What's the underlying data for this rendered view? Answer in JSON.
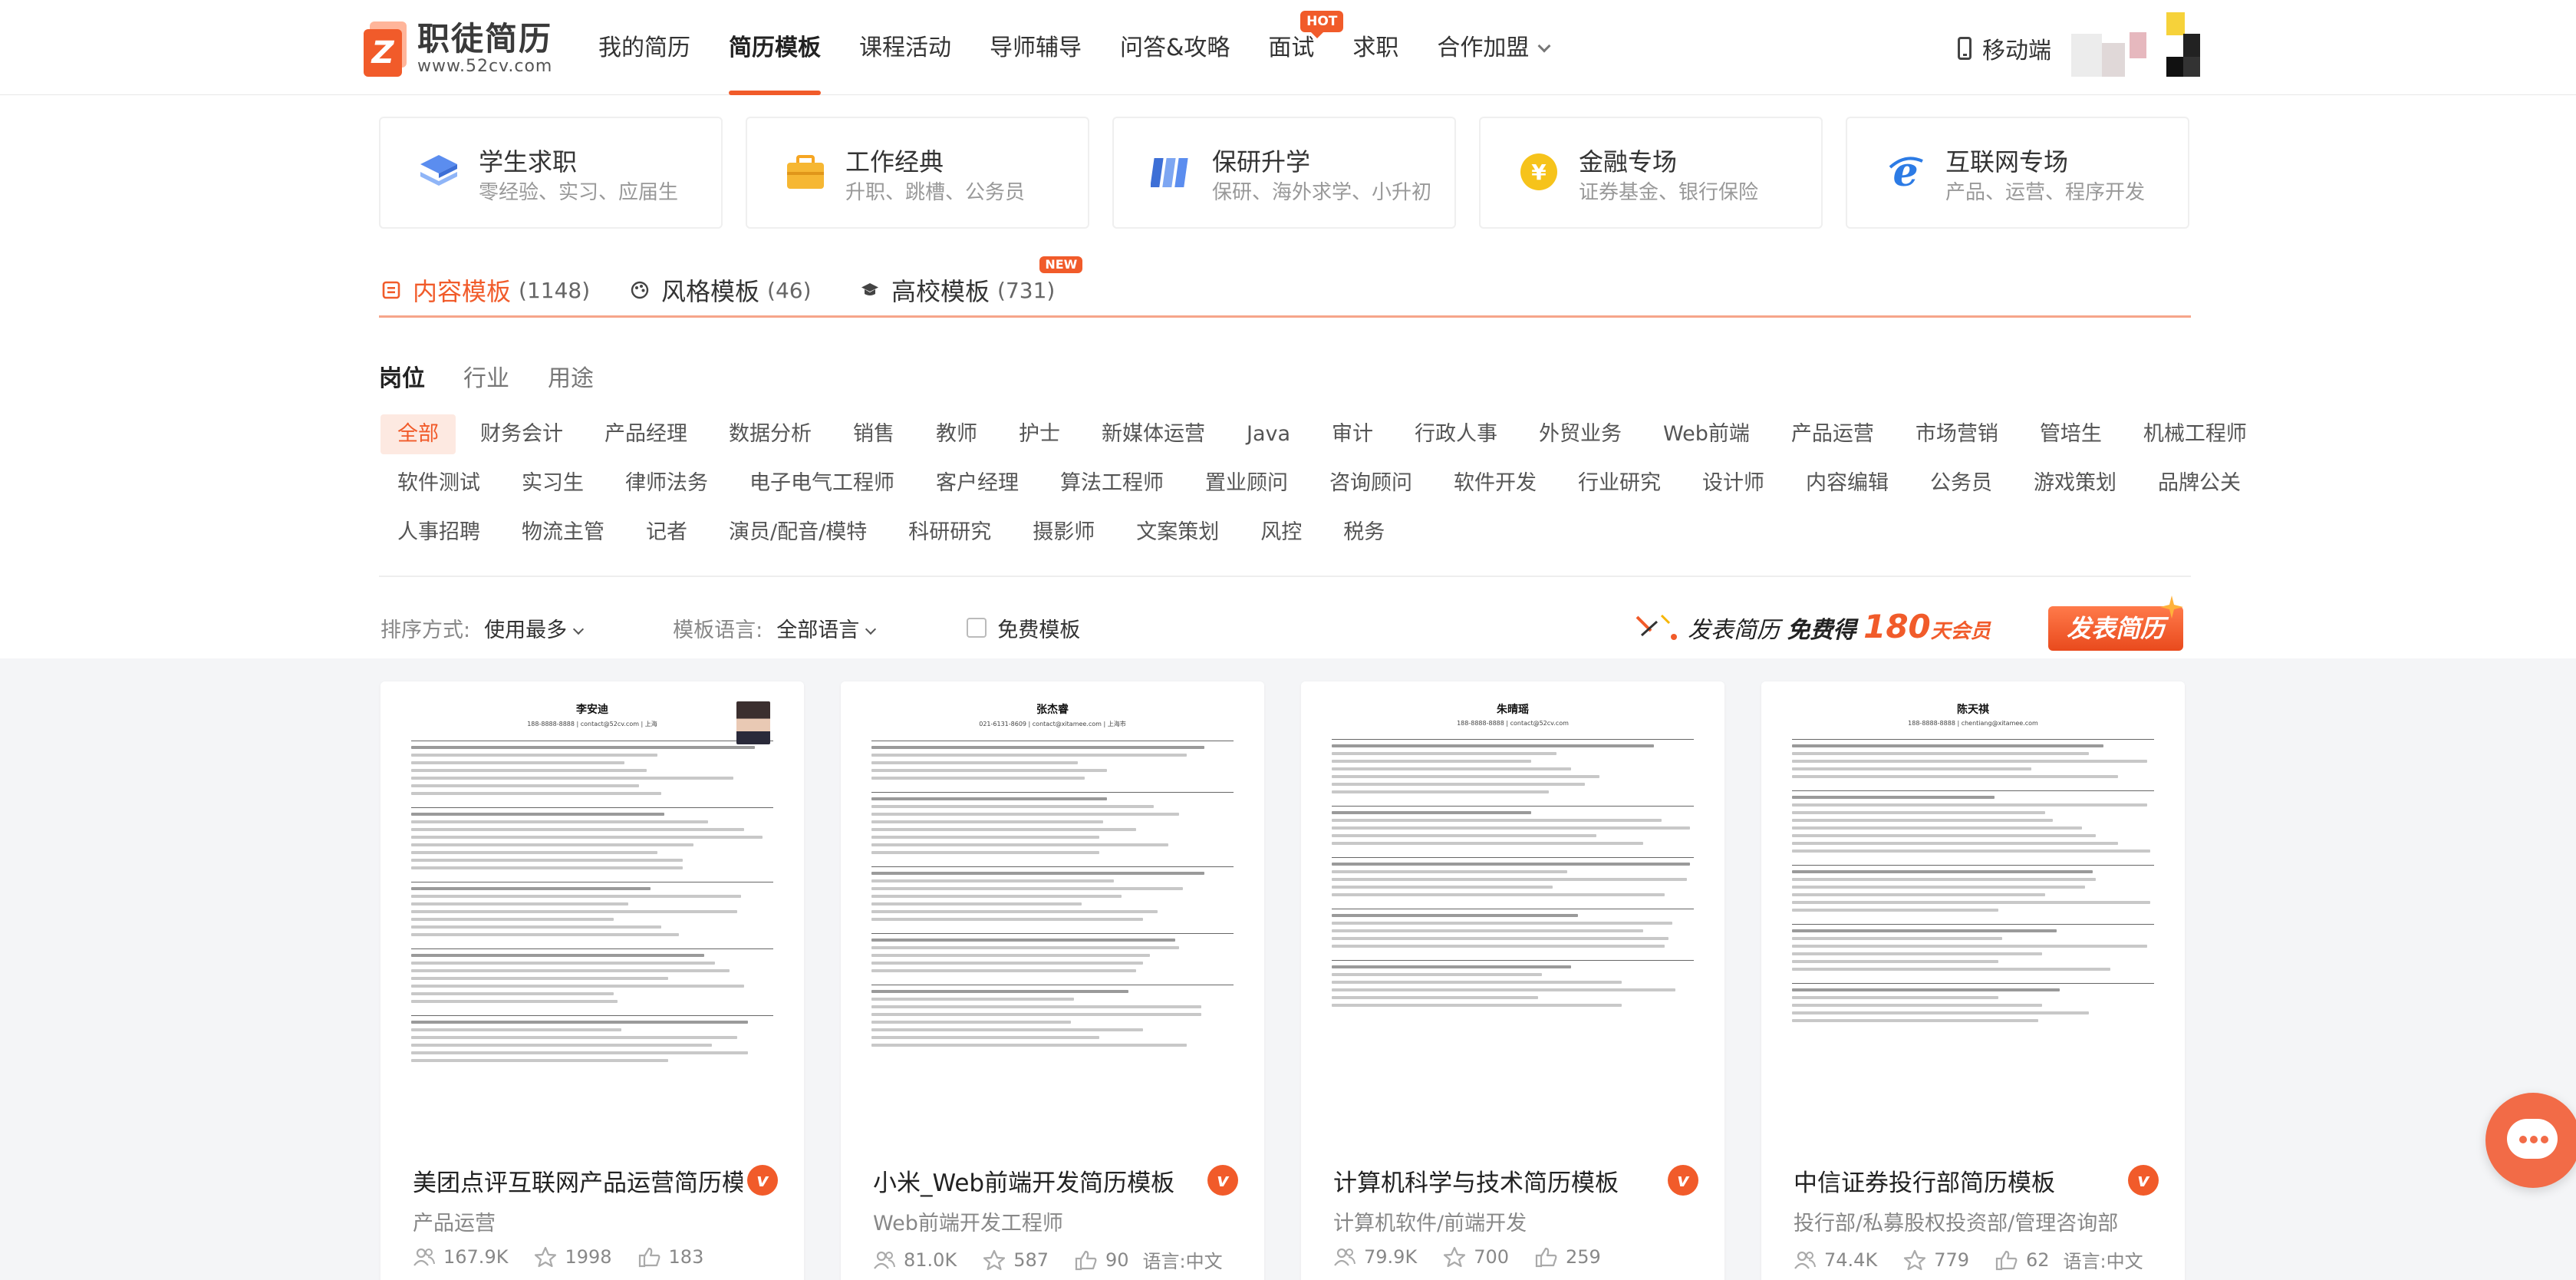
{
  "header": {
    "logo_title": "职徒简历",
    "logo_url": "www.52cv.com",
    "nav": [
      {
        "label": "我的简历"
      },
      {
        "label": "简历模板",
        "active": true
      },
      {
        "label": "课程活动"
      },
      {
        "label": "导师辅导"
      },
      {
        "label": "问答&攻略"
      },
      {
        "label": "面试",
        "badge": "HOT"
      },
      {
        "label": "求职"
      },
      {
        "label": "合作加盟"
      }
    ],
    "mobile": "移动端"
  },
  "categories": [
    {
      "title": "学生求职",
      "sub": "零经验、实习、应届生",
      "icon": "student-cap-icon"
    },
    {
      "title": "工作经典",
      "sub": "升职、跳槽、公务员",
      "icon": "briefcase-icon"
    },
    {
      "title": "保研升学",
      "sub": "保研、海外求学、小升初",
      "icon": "books-icon"
    },
    {
      "title": "金融专场",
      "sub": "证券基金、银行保险",
      "icon": "yuan-coin-icon"
    },
    {
      "title": "互联网专场",
      "sub": "产品、运营、程序开发",
      "icon": "ie-browser-icon"
    }
  ],
  "tabs": [
    {
      "label": "内容模板",
      "count": "(1148)"
    },
    {
      "label": "风格模板",
      "count": "(46)"
    },
    {
      "label": "高校模板",
      "count": "(731)",
      "badge": "NEW"
    }
  ],
  "subtabs": [
    "岗位",
    "行业",
    "用途"
  ],
  "tags": [
    [
      "全部",
      "财务会计",
      "产品经理",
      "数据分析",
      "销售",
      "教师",
      "护士",
      "新媒体运营",
      "Java",
      "审计",
      "行政人事",
      "外贸业务",
      "Web前端",
      "产品运营",
      "市场营销",
      "管培生",
      "机械工程师"
    ],
    [
      "软件测试",
      "实习生",
      "律师法务",
      "电子电气工程师",
      "客户经理",
      "算法工程师",
      "置业顾问",
      "咨询顾问",
      "软件开发",
      "行业研究",
      "设计师",
      "内容编辑",
      "公务员",
      "游戏策划",
      "品牌公关"
    ],
    [
      "人事招聘",
      "物流主管",
      "记者",
      "演员/配音/模特",
      "科研研究",
      "摄影师",
      "文案策划",
      "风控",
      "税务"
    ]
  ],
  "sort": {
    "label": "排序方式:",
    "value": "使用最多",
    "lang_label": "模板语言:",
    "lang_value": "全部语言",
    "free": "免费模板"
  },
  "promo": {
    "text1": "发表简历",
    "text2": "免费得",
    "num": "180",
    "unit": "天会员",
    "button": "发表简历"
  },
  "cards": [
    {
      "title": "美团点评互联网产品运营简历模板",
      "sub": "产品运营",
      "views": "167.9K",
      "stars": "1998",
      "likes": "183",
      "lang": "",
      "resume_name": "李安迪",
      "resume_contact": "188-8888-8888 | contact@52cv.com | 上海",
      "has_photo": true
    },
    {
      "title": "小米_Web前端开发简历模板",
      "sub": "Web前端开发工程师",
      "views": "81.0K",
      "stars": "587",
      "likes": "90",
      "lang": "语言:中文",
      "resume_name": "张杰睿",
      "resume_contact": "021-6131-8609 | contact@xitamee.com | 上海市",
      "has_photo": false
    },
    {
      "title": "计算机科学与技术简历模板",
      "sub": "计算机软件/前端开发",
      "views": "79.9K",
      "stars": "700",
      "likes": "259",
      "lang": "",
      "resume_name": "朱晴瑶",
      "resume_contact": "188-8888-8888 | contact@52cv.com",
      "has_photo": false
    },
    {
      "title": "中信证券投行部简历模板",
      "sub": "投行部/私募股权投资部/管理咨询部",
      "views": "74.4K",
      "stars": "779",
      "likes": "62",
      "lang": "语言:中文",
      "resume_name": "陈天祺",
      "resume_contact": "188-8888-8888 | chentiang@xitamee.com",
      "has_photo": false
    }
  ],
  "colors": {
    "accent": "#f15b2a",
    "accent_light": "#fde9e1"
  }
}
